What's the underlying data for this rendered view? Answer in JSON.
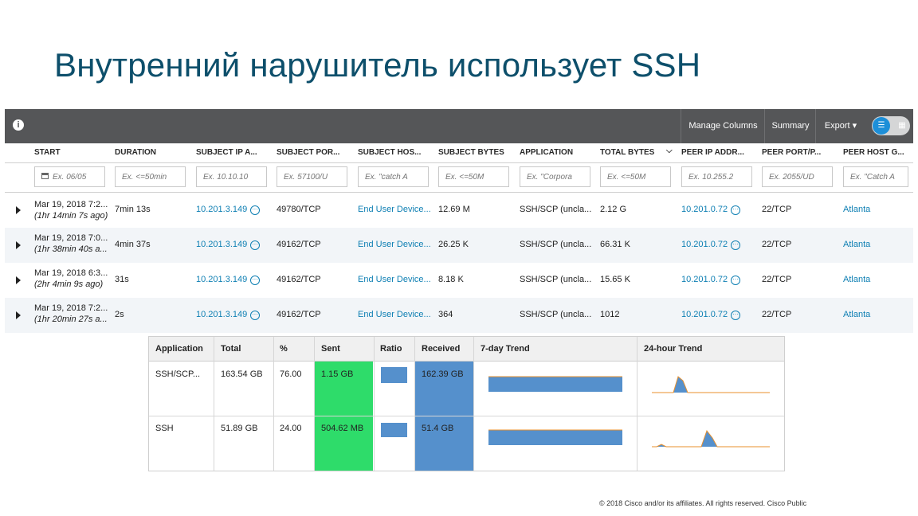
{
  "slide": {
    "title": "Внутренний нарушитель использует SSH",
    "footer": "© 2018  Cisco and/or its affiliates. All rights reserved.   Cisco Public"
  },
  "toolbar": {
    "info": "i",
    "manage_columns": "Manage Columns",
    "summary": "Summary",
    "export": "Export ▾",
    "toggle_list": "☰",
    "toggle_grid": "▦"
  },
  "columns": [
    "START",
    "DURATION",
    "SUBJECT IP A...",
    "SUBJECT POR...",
    "SUBJECT HOS...",
    "SUBJECT BYTES",
    "APPLICATION",
    "TOTAL BYTES",
    "PEER IP ADDR...",
    "PEER PORT/P...",
    "PEER HOST G..."
  ],
  "sort_indicator": "⌵",
  "filters": [
    "Ex. 06/05",
    "Ex. <=50min",
    "Ex. 10.10.10",
    "Ex. 57100/U",
    "Ex. \"catch A",
    "Ex. <=50M",
    "Ex. \"Corpora",
    "Ex. <=50M",
    "Ex. 10.255.2",
    "Ex. 2055/UD",
    "Ex. \"Catch A"
  ],
  "rows": [
    {
      "start": "Mar 19, 2018 7:2...",
      "ago": "(1hr 14min 7s ago)",
      "duration": "7min 13s",
      "subject_ip": "10.201.3.149",
      "subject_port": "49780/TCP",
      "subject_host": "End User Device...",
      "subject_bytes": "12.69 M",
      "application": "SSH/SCP (uncla...",
      "total_bytes": "2.12 G",
      "peer_ip": "10.201.0.72",
      "peer_port": "22/TCP",
      "peer_host": "Atlanta"
    },
    {
      "start": "Mar 19, 2018 7:0...",
      "ago": "(1hr 38min 40s a...",
      "duration": "4min 37s",
      "subject_ip": "10.201.3.149",
      "subject_port": "49162/TCP",
      "subject_host": "End User Device...",
      "subject_bytes": "26.25 K",
      "application": "SSH/SCP (uncla...",
      "total_bytes": "66.31 K",
      "peer_ip": "10.201.0.72",
      "peer_port": "22/TCP",
      "peer_host": "Atlanta"
    },
    {
      "start": "Mar 19, 2018 6:3...",
      "ago": "(2hr 4min 9s ago)",
      "duration": "31s",
      "subject_ip": "10.201.3.149",
      "subject_port": "49162/TCP",
      "subject_host": "End User Device...",
      "subject_bytes": "8.18 K",
      "application": "SSH/SCP (uncla...",
      "total_bytes": "15.65 K",
      "peer_ip": "10.201.0.72",
      "peer_port": "22/TCP",
      "peer_host": "Atlanta"
    },
    {
      "start": "Mar 19, 2018 7:2...",
      "ago": "(1hr 20min 27s a...",
      "duration": "2s",
      "subject_ip": "10.201.3.149",
      "subject_port": "49162/TCP",
      "subject_host": "End User Device...",
      "subject_bytes": "364",
      "application": "SSH/SCP (uncla...",
      "total_bytes": "1012",
      "peer_ip": "10.201.0.72",
      "peer_port": "22/TCP",
      "peer_host": "Atlanta"
    }
  ],
  "summary": {
    "headers": [
      "Application",
      "Total",
      "%",
      "Sent",
      "Ratio",
      "Received",
      "7-day Trend",
      "24-hour Trend"
    ],
    "rows": [
      {
        "application": "SSH/SCP...",
        "total": "163.54 GB",
        "percent": "76.00",
        "sent": "1.15 GB",
        "received": "162.39 GB"
      },
      {
        "application": "SSH",
        "total": "51.89 GB",
        "percent": "24.00",
        "sent": "504.62 MB",
        "received": "51.4 GB"
      }
    ]
  },
  "colors": {
    "sent_fill": "#2edc6a",
    "received_fill": "#5590cc",
    "trend_line": "#e8902e",
    "link": "#0e7fb3",
    "toolbar": "#555658",
    "title": "#0d4f6b"
  }
}
